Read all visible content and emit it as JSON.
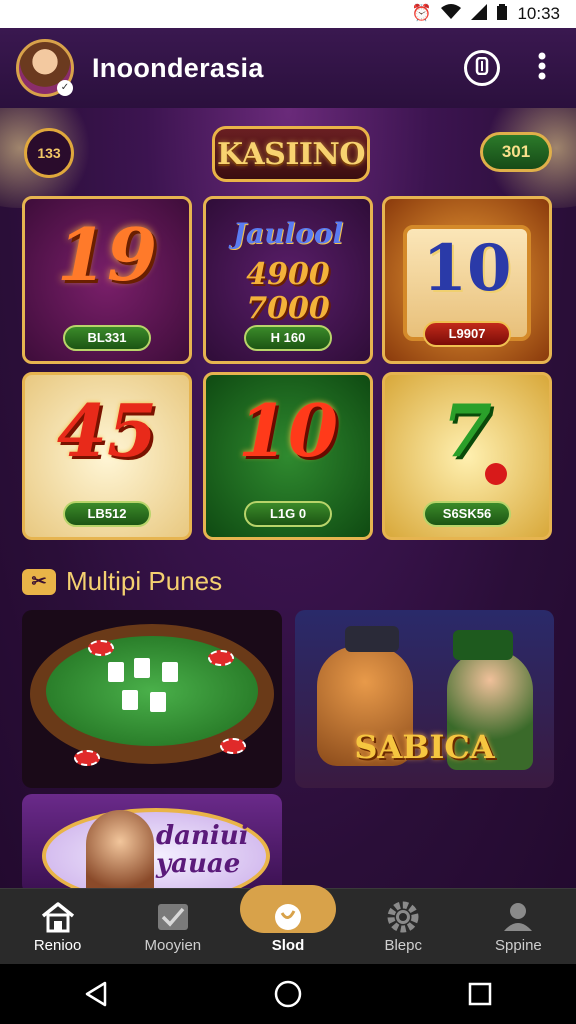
{
  "status_bar": {
    "time": "10:33",
    "icons": [
      "alarm-icon",
      "wifi-icon",
      "signal-icon",
      "battery-icon"
    ]
  },
  "header": {
    "title": "Inoonderasia",
    "chip_icon": "ticket-icon",
    "more_icon": "more-vertical-icon"
  },
  "top_bar": {
    "coin_value": "133",
    "brand": "KASIINO",
    "balance": "301"
  },
  "slot_tiles": [
    {
      "big": "19",
      "pill": "BL331"
    },
    {
      "head": "Jaulool",
      "line1": "4900",
      "line2": "7000",
      "pill": "H 160"
    },
    {
      "big": "10",
      "pill": "L9907"
    },
    {
      "big": "45",
      "pill": "LB512"
    },
    {
      "big": "10",
      "pill": "L1G 0"
    },
    {
      "big": "7",
      "pill": "S6SK56"
    }
  ],
  "section": {
    "icon_text": "✂",
    "title": "Multipi Punes"
  },
  "feature_cards": {
    "hero_title": "SABICA",
    "promo_text": "daniui yauae"
  },
  "bottom_nav": [
    {
      "label": "Renioo",
      "icon": "home-icon"
    },
    {
      "label": "Mooyien",
      "icon": "checklist-icon"
    },
    {
      "label": "Slod",
      "icon": "slot-icon"
    },
    {
      "label": "Blepc",
      "icon": "gear-icon"
    },
    {
      "label": "Sppine",
      "icon": "profile-icon"
    }
  ],
  "colors": {
    "accent_gold": "#e9b448",
    "background_purple": "#2a0e38",
    "nav_active": "#d8a24a"
  }
}
